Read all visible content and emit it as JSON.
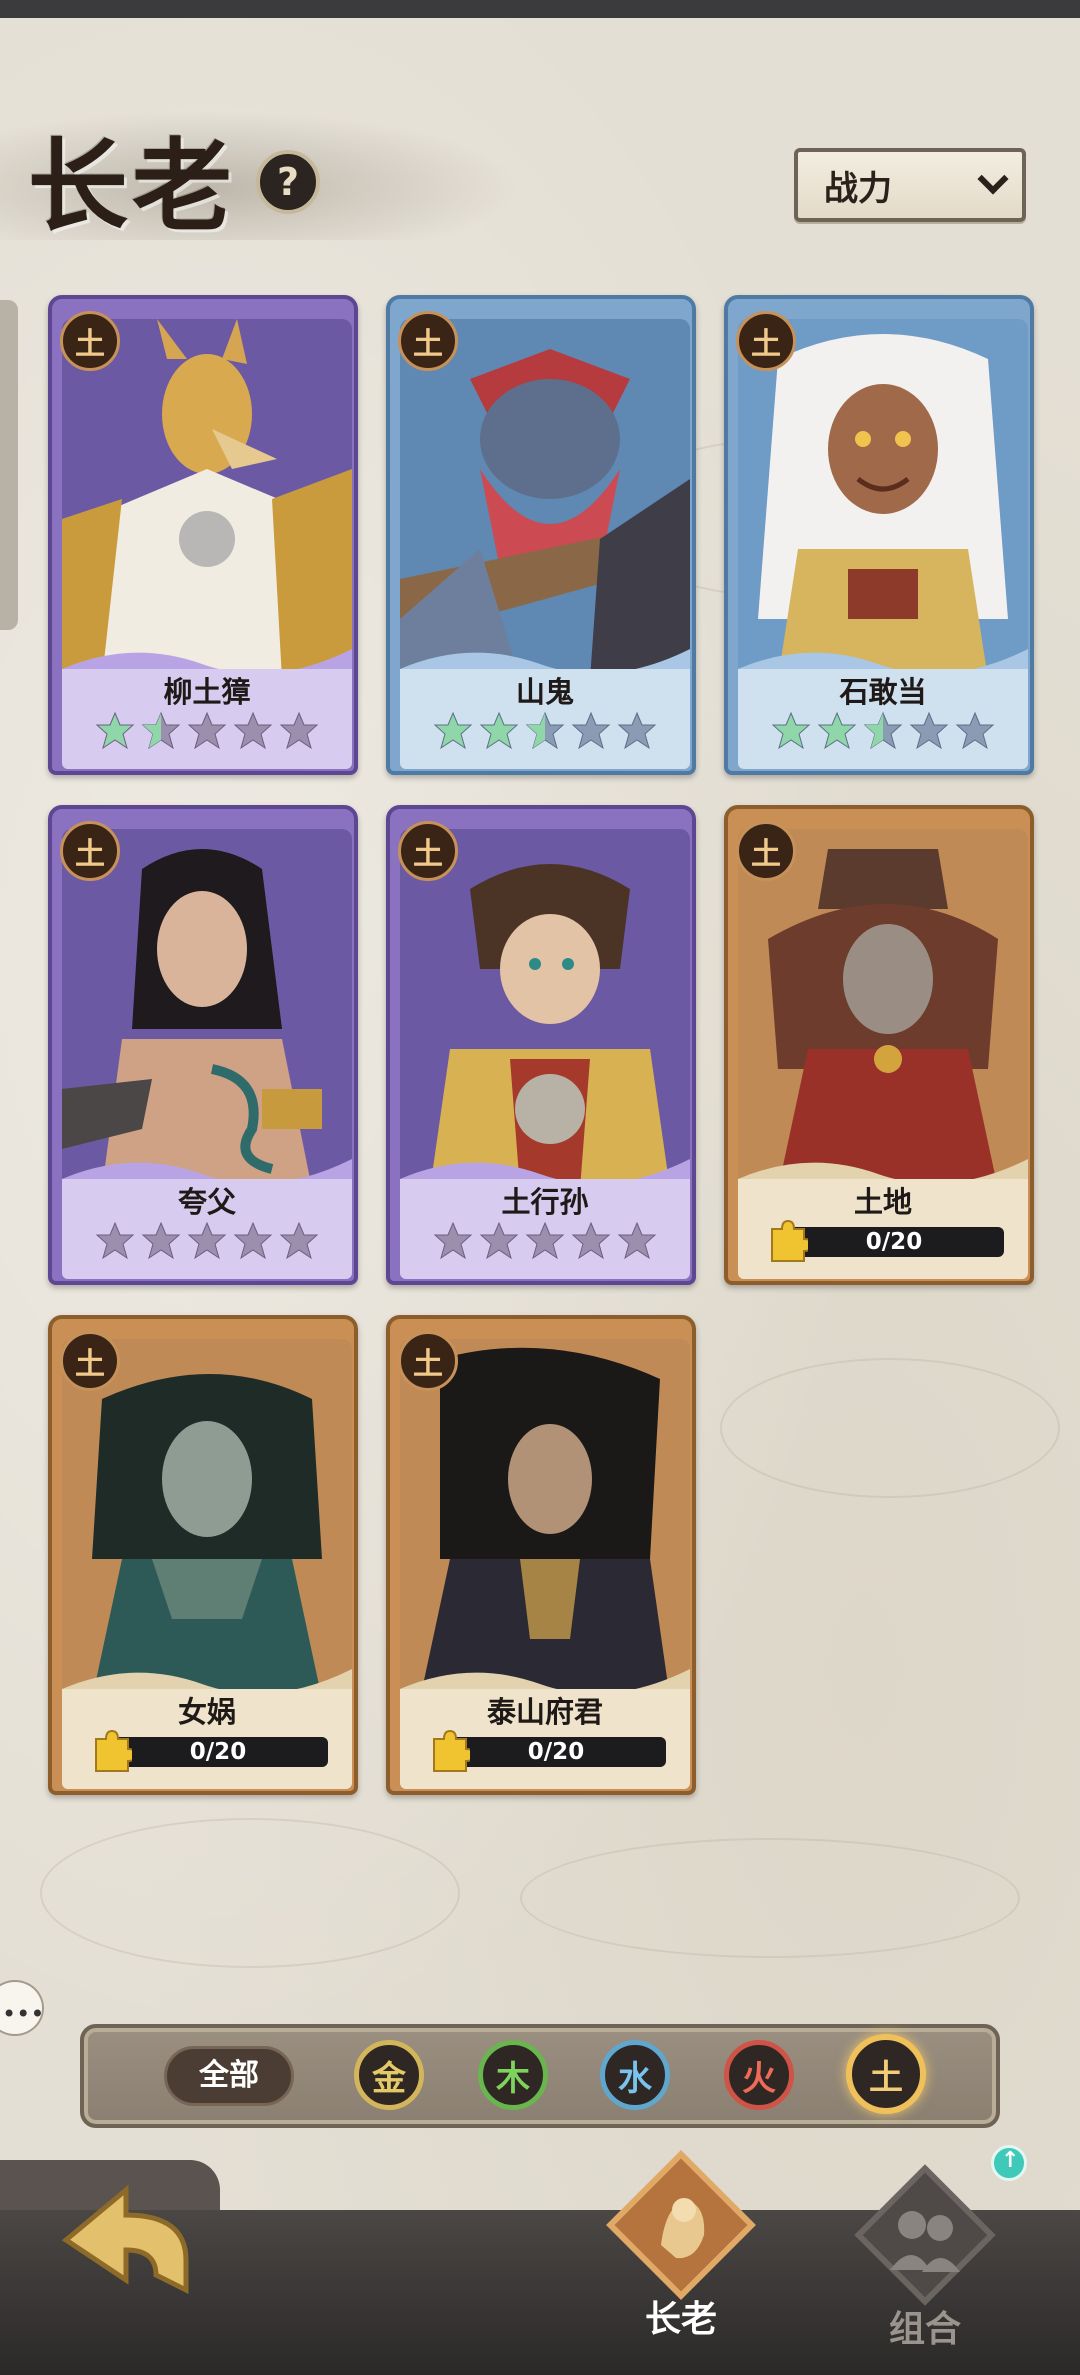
{
  "header": {
    "title": "长老",
    "help_icon": "?",
    "sort_label": "战力"
  },
  "cards": [
    {
      "name": "柳土獐",
      "element": "土",
      "rarity_color": "purple",
      "stars_lit": 1.5,
      "stars_total": 5
    },
    {
      "name": "山鬼",
      "element": "土",
      "rarity_color": "blue",
      "stars_lit": 2.5,
      "stars_total": 5
    },
    {
      "name": "石敢当",
      "element": "土",
      "rarity_color": "blue",
      "stars_lit": 2.5,
      "stars_total": 5
    },
    {
      "name": "夸父",
      "element": "土",
      "rarity_color": "purple",
      "stars_lit": 0,
      "stars_total": 5
    },
    {
      "name": "土行孙",
      "element": "土",
      "rarity_color": "purple",
      "stars_lit": 0,
      "stars_total": 5
    },
    {
      "name": "土地",
      "element": "土",
      "rarity_color": "gold",
      "shards": "0/20"
    },
    {
      "name": "女娲",
      "element": "土",
      "rarity_color": "gold",
      "shards": "0/20"
    },
    {
      "name": "泰山府君",
      "element": "土",
      "rarity_color": "gold",
      "shards": "0/20"
    }
  ],
  "filters": {
    "all_label": "全部",
    "elements": [
      "金",
      "木",
      "水",
      "火",
      "土"
    ],
    "selected": "土"
  },
  "nav": {
    "elders_label": "长老",
    "combo_label": "组合",
    "combo_badge": "↑"
  },
  "colors": {
    "purple": "#8a72c0",
    "blue": "#7fa6cd",
    "gold": "#c98f54",
    "star_lit": "#8fd6a8",
    "star_dim": "#9c8fae"
  }
}
